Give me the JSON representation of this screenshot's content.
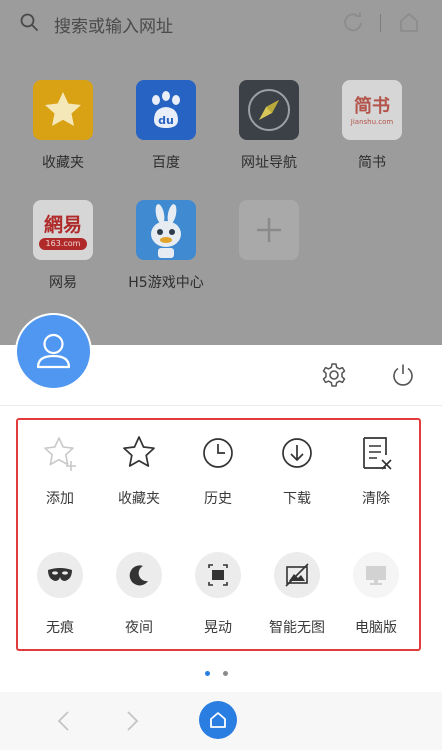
{
  "search": {
    "placeholder": "搜索或输入网址"
  },
  "shortcuts": [
    {
      "label": "收藏夹",
      "icon": "star-icon",
      "color": "#f2b71a"
    },
    {
      "label": "百度",
      "icon": "baidu-paw-icon",
      "color": "#2b6fd8"
    },
    {
      "label": "网址导航",
      "icon": "compass-icon",
      "color": "#4b5359"
    },
    {
      "label": "简书",
      "icon": "jianshu-logo-icon",
      "logo_text": "简书",
      "logo_sub": "Jianshu.com",
      "color": "#f3f3f3"
    },
    {
      "label": "网易",
      "icon": "netease-logo-icon",
      "logo_text": "網易",
      "logo_sub": "163.com",
      "color": "#f3f3f3"
    },
    {
      "label": "H5游戏中心",
      "icon": "h5-game-mascot-icon",
      "color": "#4fa3e8"
    },
    {
      "label": "",
      "icon": "add-icon",
      "color": "#a9a9a9"
    }
  ],
  "menu": {
    "row1": [
      {
        "label": "添加",
        "icon": "add-bookmark-icon"
      },
      {
        "label": "收藏夹",
        "icon": "star-outline-icon"
      },
      {
        "label": "历史",
        "icon": "clock-icon"
      },
      {
        "label": "下载",
        "icon": "download-icon"
      },
      {
        "label": "清除",
        "icon": "clear-icon"
      }
    ],
    "row2": [
      {
        "label": "无痕",
        "icon": "incognito-mask-icon"
      },
      {
        "label": "夜间",
        "icon": "moon-icon"
      },
      {
        "label": "晃动",
        "icon": "shake-icon"
      },
      {
        "label": "智能无图",
        "icon": "no-image-icon"
      },
      {
        "label": "电脑版",
        "icon": "desktop-icon"
      }
    ]
  },
  "colors": {
    "accent": "#2a7de1",
    "highlight_frame": "#e23b3b",
    "avatar": "#4f97f0"
  },
  "pager": {
    "pages": 2,
    "active": 1
  }
}
